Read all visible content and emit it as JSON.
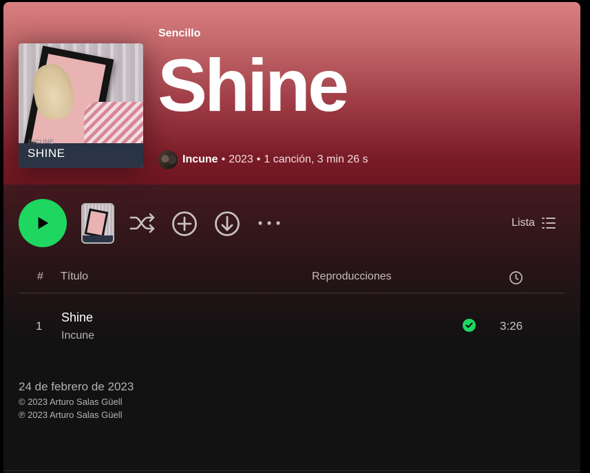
{
  "header": {
    "type_label": "Sencillo",
    "title": "Shine",
    "artist": "Incune",
    "year": "2023",
    "track_count": "1 canción, 3 min 26 s",
    "separator": "•"
  },
  "cover": {
    "small_text": "INCUNE",
    "title_text": "SHINE"
  },
  "actions": {
    "list_label": "Lista"
  },
  "table": {
    "headers": {
      "number": "#",
      "title": "Título",
      "plays": "Reproducciones",
      "duration_icon": "clock-icon"
    },
    "rows": [
      {
        "number": "1",
        "title": "Shine",
        "artist": "Incune",
        "downloaded": true,
        "duration": "3:26"
      }
    ]
  },
  "footer": {
    "release_date": "24 de febrero de 2023",
    "copyright": "© 2023 Arturo Salas Güell",
    "phonographic": "℗ 2023 Arturo Salas Güell"
  },
  "colors": {
    "accent_green": "#1ed760",
    "hero_top": "#d97f80",
    "hero_bottom": "#6d1621",
    "background": "#121212"
  },
  "icons": [
    "play-icon",
    "shuffle-icon",
    "add-circle-icon",
    "download-icon",
    "more-icon",
    "list-view-icon",
    "clock-icon",
    "downloaded-check-icon"
  ]
}
